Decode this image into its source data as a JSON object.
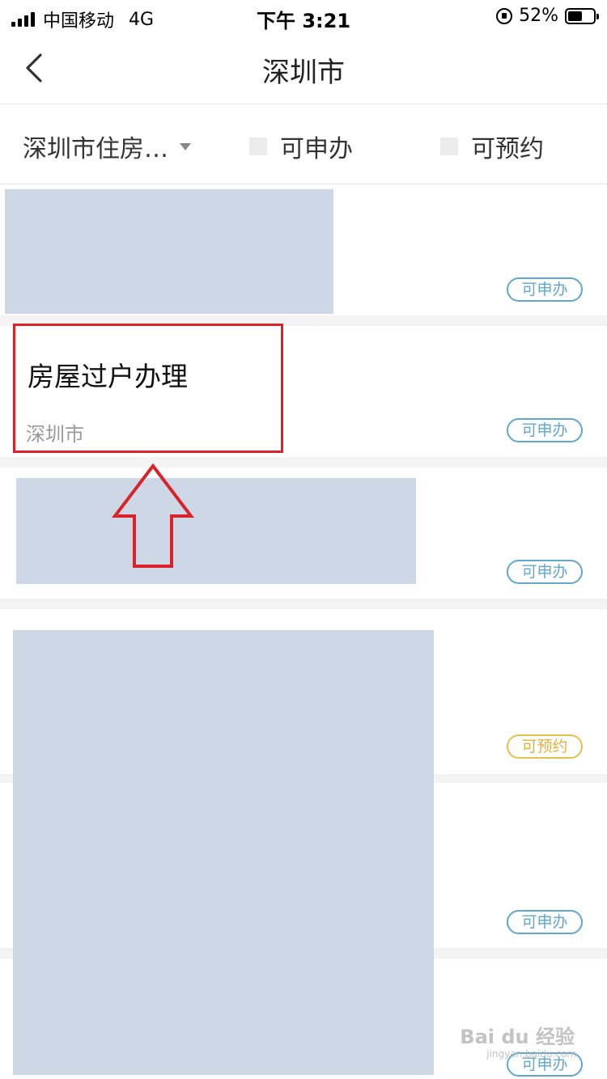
{
  "status_bar": {
    "carrier": "中国移动",
    "network": "4G",
    "time": "下午 3:21",
    "battery": "52%"
  },
  "header": {
    "title": "深圳市"
  },
  "filters": {
    "category": "深圳市住房…",
    "option_apply": "可申办",
    "option_reserve": "可预约"
  },
  "items": [
    {
      "title": "",
      "location": "",
      "tag": "可申办",
      "tag_color": "#62a7cf"
    },
    {
      "title": "房屋过户办理",
      "location": "深圳市",
      "tag": "可申办",
      "tag_color": "#62a7cf"
    },
    {
      "title": "",
      "location": "",
      "tag": "可申办",
      "tag_color": "#62a7cf"
    },
    {
      "title": "",
      "location": "",
      "tag": "可预约",
      "tag_color": "#e7bf4e"
    },
    {
      "title": "",
      "location": "",
      "tag": "可申办",
      "tag_color": "#62a7cf"
    },
    {
      "title": "",
      "location": "",
      "tag": "可申办",
      "tag_color": "#62a7cf"
    }
  ],
  "annotation": {
    "color": "#d9222a"
  },
  "watermark": {
    "text": "Bai du 经验",
    "sub": "jingyan.baidu.com"
  }
}
